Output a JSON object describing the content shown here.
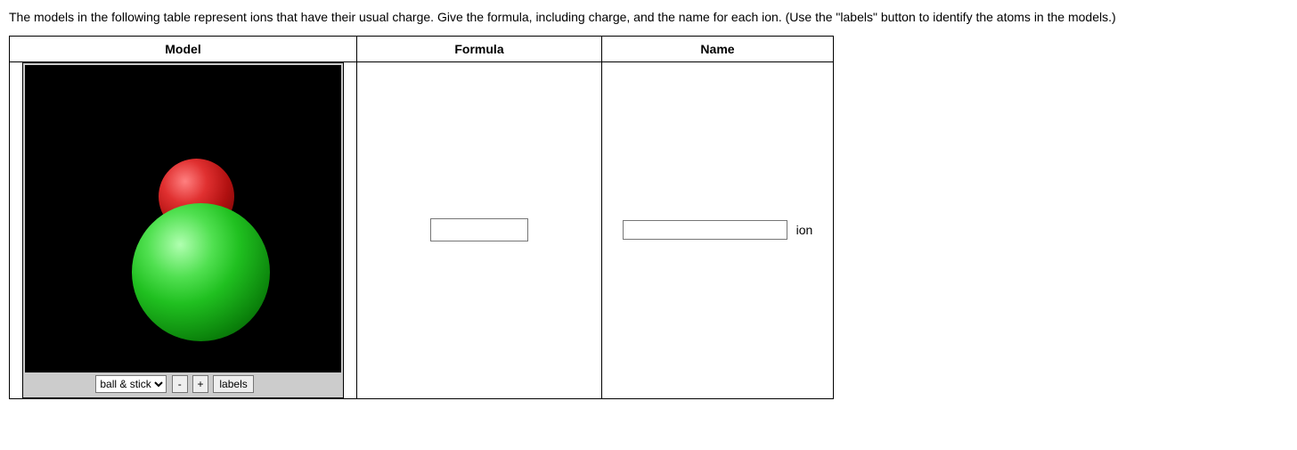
{
  "instructions": "The models in the following table represent ions that have their usual charge. Give the formula, including charge, and the name for each ion. (Use the \"labels\" button to identify the atoms in the models.)",
  "headers": {
    "model": "Model",
    "formula": "Formula",
    "name": "Name"
  },
  "controls": {
    "select_value": "ball & stick",
    "select_options": [
      "ball & stick"
    ],
    "zoom_out": "-",
    "zoom_in": "+",
    "labels": "labels"
  },
  "inputs": {
    "formula_value": "",
    "name_value": "",
    "name_suffix": "ion"
  }
}
